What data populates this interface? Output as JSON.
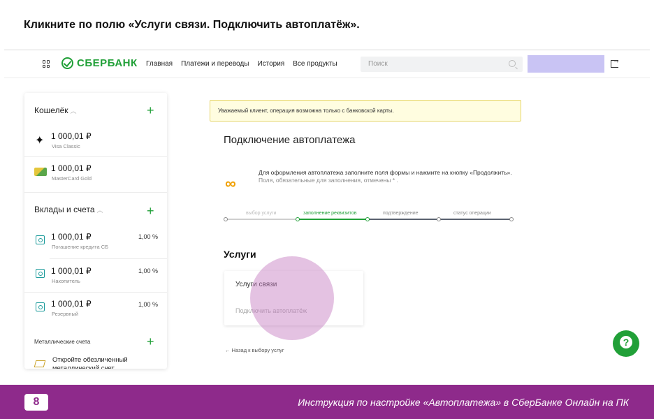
{
  "instruction": "Кликните по полю «Услуги связи. Подключить автоплатёж».",
  "header": {
    "logo_text": "СБЕРБАНК",
    "nav": [
      "Главная",
      "Платежи и переводы",
      "История",
      "Все продукты"
    ],
    "search_placeholder": "Поиск"
  },
  "sidebar": {
    "wallet_title": "Кошелёк",
    "cards": [
      {
        "amount": "1 000,01 ₽",
        "name": "Visa Classic"
      },
      {
        "amount": "1 000,01 ₽",
        "name": "MasterCard Gold"
      }
    ],
    "deposits_title": "Вклады и счета",
    "deposits": [
      {
        "amount": "1 000,01 ₽",
        "name": "Погашение кредита СБ",
        "rate": "1,00 %"
      },
      {
        "amount": "1 000,01 ₽",
        "name": "Накопитель",
        "rate": "1,00 %"
      },
      {
        "amount": "1 000,01 ₽",
        "name": "Резервный",
        "rate": "1,00 %"
      }
    ],
    "metal_title": "Металлические счета",
    "metal_text": "Откройте обезличенный металлический счет"
  },
  "main": {
    "notice": "Уважаемый клиент, операция возможна только с банковской карты.",
    "title": "Подключение автоплатежа",
    "info_line1": "Для оформления автоплатежа заполните поля формы и нажмите на кнопку «Продолжить».",
    "info_line2": "Поля, обязательные для заполнения, отмечены * .",
    "steps": [
      "выбор услуги",
      "заполнение реквизитов",
      "подтверждение",
      "статус операции"
    ],
    "active_step": 2,
    "services_title": "Услуги",
    "service_name": "Услуги связи",
    "service_action": "Подключить автоплатёж",
    "back_link": "← Назад к выбору услуг"
  },
  "footer": {
    "page_number": "8",
    "text": "Инструкция по настройке «Автоплатежа» в СберБанке Онлайн на ПК"
  },
  "colors": {
    "brand_green": "#21a038",
    "footer_purple": "#8e2a8b",
    "highlight": "#c478be"
  }
}
